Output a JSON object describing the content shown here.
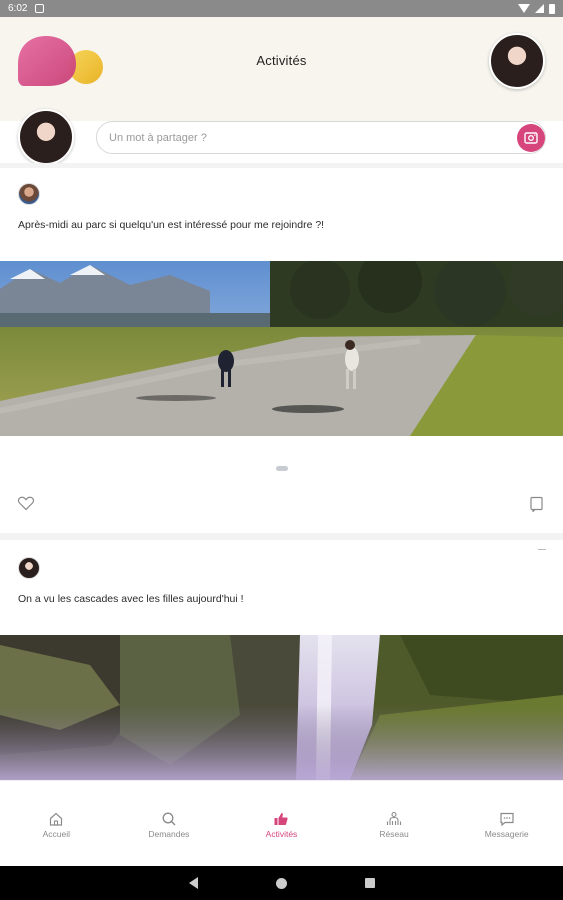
{
  "status_bar": {
    "time": "6:02"
  },
  "header": {
    "title": "Activités"
  },
  "composer": {
    "placeholder": "Un mot à partager ?"
  },
  "posts": [
    {
      "text": "Après-midi au parc si quelqu'un est intéressé pour me rejoindre ?!"
    },
    {
      "text": "On a vu les cascades avec les filles aujourd'hui !"
    }
  ],
  "bottom_nav": {
    "items": [
      {
        "label": "Accueil",
        "icon": "home-icon"
      },
      {
        "label": "Demandes",
        "icon": "search-icon"
      },
      {
        "label": "Activités",
        "icon": "thumbs-up-icon",
        "active": true
      },
      {
        "label": "Réseau",
        "icon": "network-icon"
      },
      {
        "label": "Messagerie",
        "icon": "chat-icon"
      }
    ]
  },
  "colors": {
    "accent": "#d6457b",
    "header_bg": "#f7f5ee",
    "logo_yellow": "#f0c237"
  }
}
